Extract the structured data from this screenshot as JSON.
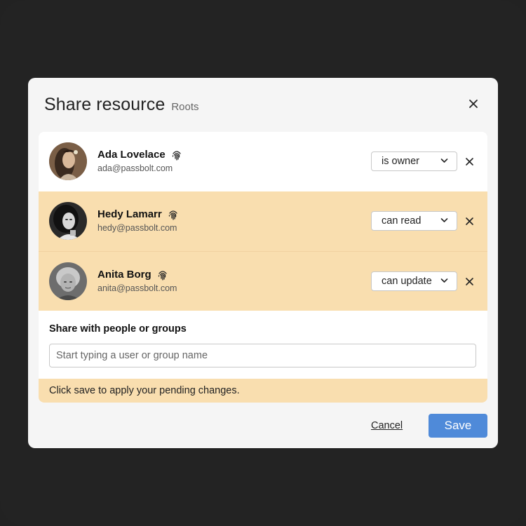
{
  "dialog": {
    "title": "Share resource",
    "subtitle": "Roots",
    "close_icon": "close-icon"
  },
  "permissions": [
    {
      "name": "Ada Lovelace",
      "email": "ada@passbolt.com",
      "permission": "is owner",
      "changed": false,
      "icon": "fingerprint-icon"
    },
    {
      "name": "Hedy Lamarr",
      "email": "hedy@passbolt.com",
      "permission": "can read",
      "changed": true,
      "icon": "fingerprint-icon"
    },
    {
      "name": "Anita Borg",
      "email": "anita@passbolt.com",
      "permission": "can update",
      "changed": true,
      "icon": "fingerprint-icon"
    }
  ],
  "share": {
    "label": "Share with people or groups",
    "placeholder": "Start typing a user or group name",
    "value": ""
  },
  "pending_message": "Click save to apply your pending changes.",
  "footer": {
    "cancel_label": "Cancel",
    "save_label": "Save"
  },
  "colors": {
    "backdrop": "#232323",
    "dialog": "#f5f5f5",
    "changed_row": "#f9deaf",
    "save_button": "#4f8ad9"
  }
}
